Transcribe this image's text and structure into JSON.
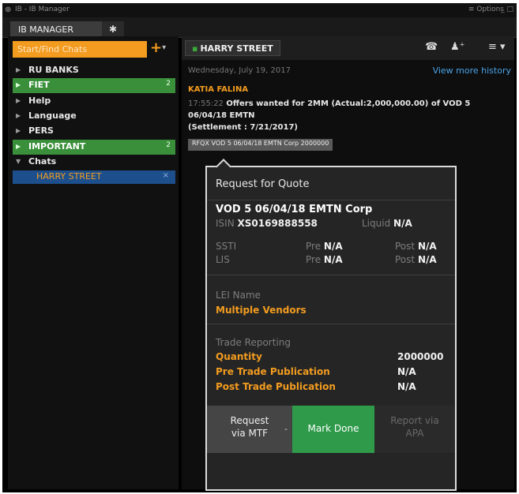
{
  "window": {
    "title": "IB - IB Manager",
    "options": "≡ Options",
    "window_controls": "_ □"
  },
  "tabs": {
    "main": "IB MANAGER",
    "bell_icon": "bell-icon"
  },
  "sidebar": {
    "search_placeholder": "Start/Find Chats",
    "add_button": "+",
    "items": [
      {
        "label": "RU BANKS",
        "expanded": false,
        "highlight": false,
        "count": ""
      },
      {
        "label": "FIET",
        "expanded": false,
        "highlight": true,
        "count": "2"
      },
      {
        "label": "Help",
        "expanded": false,
        "highlight": false,
        "count": ""
      },
      {
        "label": "Language",
        "expanded": false,
        "highlight": false,
        "count": ""
      },
      {
        "label": "PERS",
        "expanded": false,
        "highlight": false,
        "count": ""
      },
      {
        "label": "IMPORTANT",
        "expanded": false,
        "highlight": true,
        "count": "2"
      },
      {
        "label": "Chats",
        "expanded": true,
        "highlight": false,
        "count": ""
      }
    ],
    "active_chat": "HARRY STREET",
    "active_chat_close": "×"
  },
  "chat": {
    "room": "HARRY STREET",
    "date": "Wednesday, July 19, 2017",
    "view_more": "View more history",
    "sender": "KATIA FALINA",
    "time": "17:55:22",
    "message_line1": "Offers wanted for 2MM (Actual:2,000,000.00) of VOD 5",
    "message_line2": "06/04/18 EMTN",
    "message_line3": "(Settlement : 7/21/2017)",
    "rfq_tag": "RFQX VOD 5 06/04/18 EMTN Corp 2000000"
  },
  "rfq": {
    "title": "Request for Quote",
    "security": "VOD 5 06/04/18 EMTN Corp",
    "isin_label": "ISIN",
    "isin": "XS0169888558",
    "liquid_label": "Liquid",
    "liquid": "N/A",
    "ssti_label": "SSTI",
    "lis_label": "LIS",
    "pre_label": "Pre",
    "post_label": "Post",
    "ssti_pre": "N/A",
    "ssti_post": "N/A",
    "lis_pre": "N/A",
    "lis_post": "N/A",
    "lei_label": "LEI Name",
    "lei_value": "Multiple Vendors",
    "trade_reporting_label": "Trade Reporting",
    "quantity_label": "Quantity",
    "quantity": "2000000",
    "pre_trade_label": "Pre Trade Publication",
    "pre_trade": "N/A",
    "post_trade_label": "Post Trade Publication",
    "post_trade": "N/A",
    "btn_mtf_line1": "Request",
    "btn_mtf_line2": "via MTF",
    "btn_done": "Mark Done",
    "btn_apa_line1": "Report via",
    "btn_apa_line2": "APA"
  },
  "colors": {
    "accent_orange": "#f39c1f",
    "highlight_green": "#3a8f3a",
    "mark_done_green": "#2e9a4a",
    "selection_blue": "#1d4f8c",
    "link_blue": "#4aa3e8"
  }
}
